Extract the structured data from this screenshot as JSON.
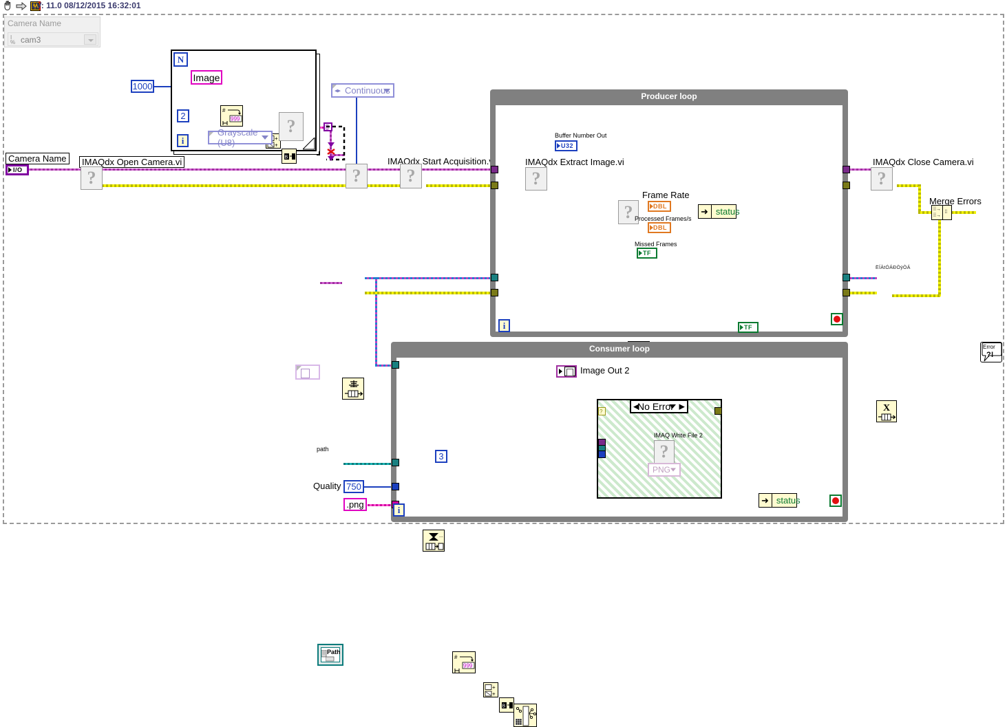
{
  "titlebar": {
    "text": "LV: 11.0 08/12/2015 16:32:01",
    "icons": [
      "hand-cursor-icon",
      "right-arrow-icon",
      "labview-vi-icon"
    ]
  },
  "front_panel_control": {
    "label": "Camera Name",
    "value": "cam3",
    "glyph": "I/O"
  },
  "left_section": {
    "camera_name_label": "Camera Name",
    "camera_name_terminal": "I/O",
    "open_camera_vi": "IMAQdx Open Camera.vi",
    "start_acquisition_vi": "IMAQdx Start Acquisition.vi",
    "continuous_enum": "Continuous"
  },
  "for_loop": {
    "count_label": "N",
    "count_value": "1000",
    "image_constant": "Image",
    "index_label": "i",
    "ring_value": "2",
    "color_mode": "Grayscale (U8)"
  },
  "producer_loop": {
    "title": "Producer loop",
    "buffer_number_out_label": "Buffer Number Out",
    "buffer_number_out_type": "U32",
    "extract_image_vi": "IMAQdx Extract Image.vi",
    "frame_rate_label": "Frame Rate",
    "frame_rate_type": "DBL",
    "processed_frames_label": "Processed Frames/s",
    "processed_frames_type": "DBL",
    "missed_frames_label": "Missed Frames",
    "missed_frames_type": "TF",
    "status_label": "status",
    "iteration_label": "i",
    "bool_constant": "TF",
    "or_gate": "or-gate",
    "stop_terminal": "stop-button"
  },
  "consumer_loop": {
    "title": "Consumer loop",
    "image_out_label": "Image Out 2",
    "case_selector": "No Error",
    "write_file_vi": "IMAQ Write File 2",
    "format_selector": "PNG",
    "status_label": "status",
    "path_label": "path",
    "path_value": "Path",
    "quality_label": "Quality",
    "quality_value": "750",
    "extension_value": ".png",
    "digits_constant": "3",
    "iteration_label": "i",
    "stop_terminal": "stop-button"
  },
  "right_section": {
    "close_camera_vi": "IMAQdx Close Camera.vi",
    "merge_errors_label": "Merge Errors",
    "error_handler_line1": "Error",
    "error_handler_line2": "?!"
  },
  "queue": {
    "release_queue_label": "ËÍÀtÓÁÐÒÿÒÁ"
  },
  "colors": {
    "error_wire": "#f2f200",
    "image_wire": "#c040c0",
    "numeric_wire": "#1b3fbe",
    "path_wire": "#19b2b2",
    "boolean_wire": "#0a7a30",
    "loop_frame": "#808080",
    "title_text": "#3b3b6e"
  }
}
